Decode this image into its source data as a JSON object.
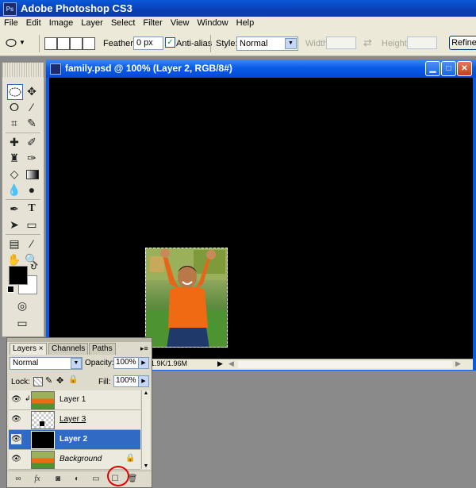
{
  "app": {
    "title": "Adobe Photoshop CS3",
    "logo_text": "Ps"
  },
  "menu": [
    "File",
    "Edit",
    "Image",
    "Layer",
    "Select",
    "Filter",
    "View",
    "Window",
    "Help"
  ],
  "options": {
    "feather_label": "Feather:",
    "feather_value": "0 px",
    "antialias_label": "Anti-alias",
    "antialias_checked": true,
    "style_label": "Style:",
    "style_value": "Normal",
    "width_label": "Width:",
    "height_label": "Height:",
    "refine_label": "Refine"
  },
  "document": {
    "title": "family.psd @ 100% (Layer 2, RGB/8#)",
    "status": "1.9K/1.96M",
    "canvas_color": "#000000"
  },
  "layers_panel": {
    "tabs": [
      "Layers ×",
      "Channels",
      "Paths"
    ],
    "blend_mode": "Normal",
    "opacity_label": "Opacity:",
    "opacity_value": "100%",
    "lock_label": "Lock:",
    "fill_label": "Fill:",
    "fill_value": "100%",
    "layers": [
      {
        "name": "Layer 1",
        "visible": true,
        "selected": false,
        "thumb": "photo"
      },
      {
        "name": "Layer 3",
        "visible": true,
        "selected": false,
        "thumb": "checker"
      },
      {
        "name": "Layer 2",
        "visible": true,
        "selected": true,
        "thumb": "black"
      },
      {
        "name": "Background",
        "visible": true,
        "selected": false,
        "thumb": "photo",
        "locked": true
      }
    ],
    "bottom_icons": [
      "link-icon",
      "fx-icon",
      "mask-icon",
      "adjustment-icon",
      "folder-icon",
      "new-layer-icon",
      "trash-icon"
    ]
  },
  "colors": {
    "selection_blue": "#316ac5",
    "annotation_red": "#e00000"
  }
}
